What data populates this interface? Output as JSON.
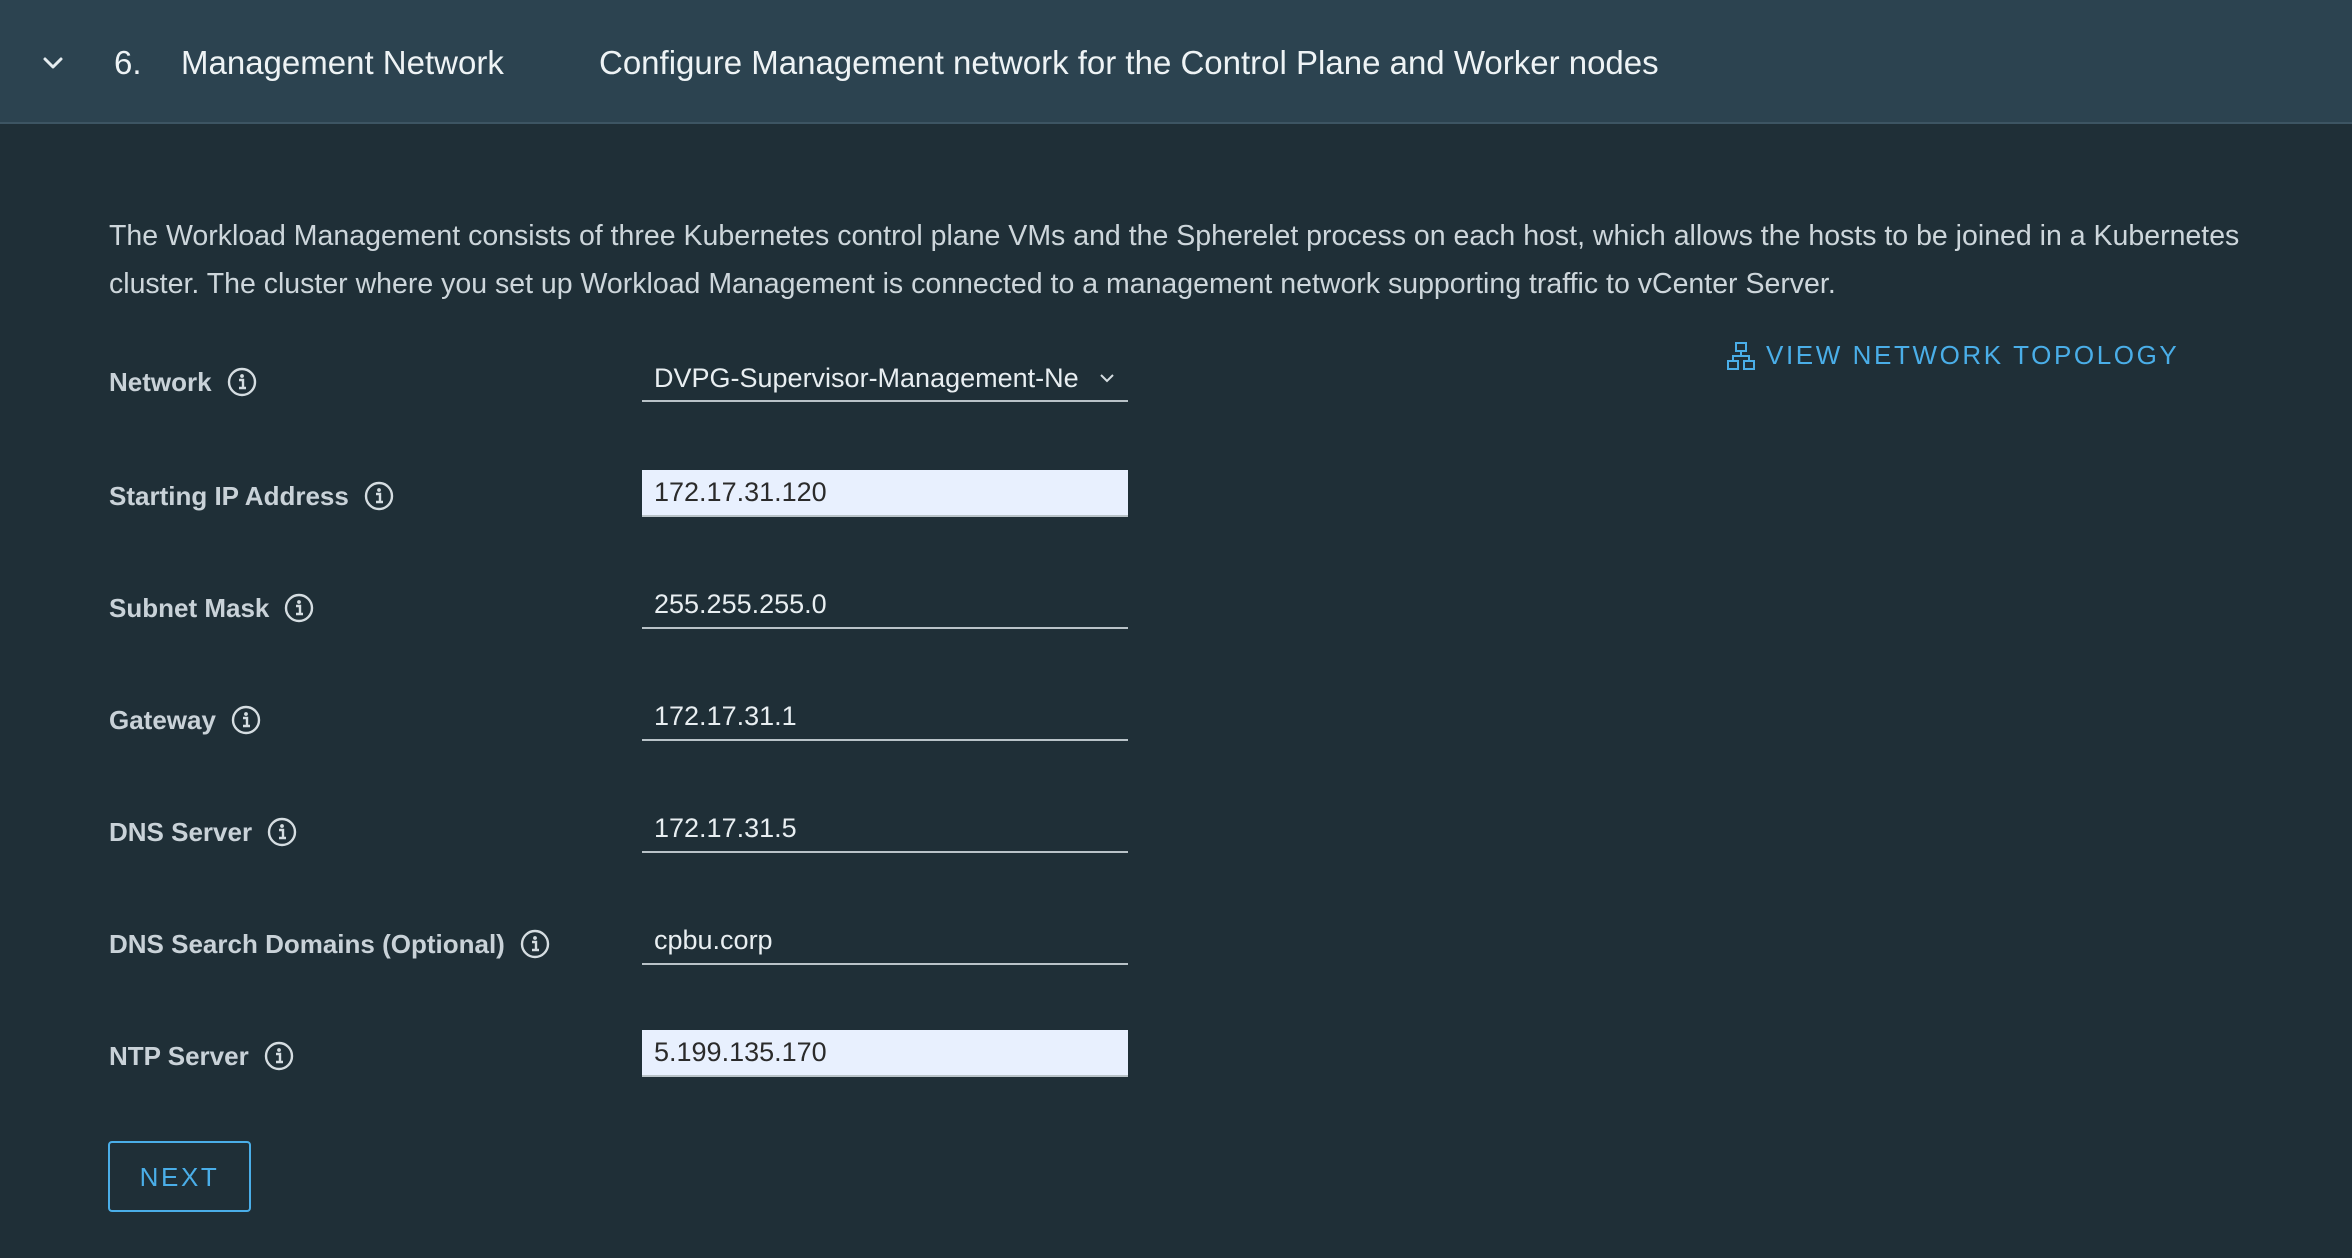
{
  "header": {
    "step_number": "6.",
    "step_title": "Management Network",
    "step_description": "Configure Management network for the Control Plane and Worker nodes",
    "collapse_icon": "chevron-down-icon"
  },
  "intro_text": "The Workload Management consists of three Kubernetes control plane VMs and the Spherelet process on each host, which allows the hosts to be joined in a Kubernetes cluster. The cluster where you set up Workload Management is connected to a management network supporting traffic to vCenter Server.",
  "topology_link": {
    "label": "VIEW NETWORK TOPOLOGY",
    "icon": "network-topology-icon"
  },
  "form": {
    "network": {
      "label": "Network",
      "value": "DVPG-Supervisor-Management-Ne"
    },
    "starting_ip": {
      "label": "Starting IP Address",
      "value": "172.17.31.120"
    },
    "subnet_mask": {
      "label": "Subnet Mask",
      "value": "255.255.255.0"
    },
    "gateway": {
      "label": "Gateway",
      "value": "172.17.31.1"
    },
    "dns_server": {
      "label": "DNS Server",
      "value": "172.17.31.5"
    },
    "dns_search_domains": {
      "label": "DNS Search Domains (Optional)",
      "value": "cpbu.corp"
    },
    "ntp_server": {
      "label": "NTP Server",
      "value": "5.199.135.170"
    }
  },
  "actions": {
    "next_label": "NEXT"
  },
  "colors": {
    "background": "#1f2f37",
    "header": "#2c4350",
    "accent": "#4aaee8",
    "autofill": "#e8f0fe"
  }
}
